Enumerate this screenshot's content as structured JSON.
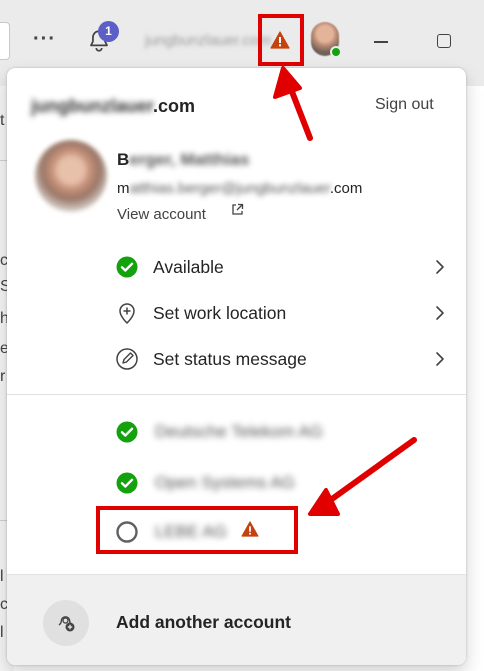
{
  "titlebar": {
    "more_label": "···",
    "notification_count": "1",
    "org_name": "jungbunzlauer.com",
    "icons": [
      "more-icon",
      "bell-icon",
      "warning-icon",
      "minimize-icon",
      "maximize-icon"
    ]
  },
  "account": {
    "tenant_prefix": "jungbunzlauer",
    "tenant_suffix": ".com",
    "sign_out": "Sign out",
    "name_initial": "B",
    "name_rest": "erger, Matthias",
    "email_prefix": "m",
    "email_middle": "atthias.berger@jungbunzlauer",
    "email_suffix": ".com",
    "view_account": "View account"
  },
  "status_menu": [
    {
      "label": "Available",
      "icon": "available-icon"
    },
    {
      "label": "Set work location",
      "icon": "location-icon"
    },
    {
      "label": "Set status message",
      "icon": "edit-status-icon"
    }
  ],
  "other_accounts": [
    {
      "name": "Deutsche Telekom AG",
      "status": "available"
    },
    {
      "name": "Open Systems AG",
      "status": "available"
    },
    {
      "name": "LEBE AG",
      "status": "offline",
      "warning": true
    }
  ],
  "footer": {
    "add_account": "Add another account"
  },
  "colors": {
    "available": "#13a10e",
    "warning": "#c4420f",
    "highlight": "#e00000",
    "badge": "#5b5fc7"
  }
}
